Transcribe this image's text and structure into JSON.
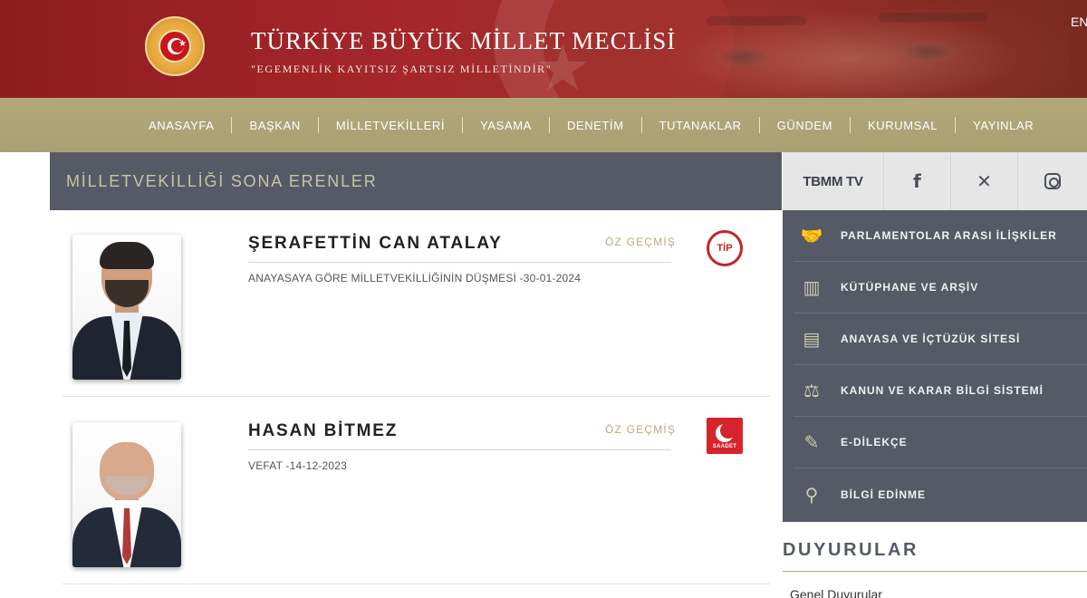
{
  "header": {
    "title": "TÜRKİYE BÜYÜK MİLLET MECLİSİ",
    "motto": "\"EGEMENLİK KAYITSIZ ŞARTSIZ MİLLETİNDİR\"",
    "lang": "EN",
    "logo_icon": "tbmm-emblem-icon"
  },
  "nav": {
    "items": [
      "ANASAYFA",
      "BAŞKAN",
      "MİLLETVEKİLLERİ",
      "YASAMA",
      "DENETİM",
      "TUTANAKLAR",
      "GÜNDEM",
      "KURUMSAL",
      "YAYINLAR"
    ]
  },
  "page": {
    "title": "MİLLETVEKİLLİĞİ SONA ERENLER"
  },
  "members": [
    {
      "name": "ŞERAFETTİN CAN ATALAY",
      "cv_label": "ÖZ GEÇMİŞ",
      "status": "ANAYASAYA GÖRE MİLLETVEKİLLİĞİNİN DÜŞMESİ -30-01-2024",
      "party_logo_text": "TİP",
      "party_color": "#c3262a"
    },
    {
      "name": "HASAN BİTMEZ",
      "cv_label": "ÖZ GEÇMİŞ",
      "status": "VEFAT -14-12-2023",
      "party_logo_text": "SAADET",
      "party_color": "#d7232c"
    }
  ],
  "sidebar": {
    "tv_label": "TBMM TV",
    "social_icons": [
      "facebook-icon",
      "x-icon",
      "instagram-icon"
    ],
    "links": [
      {
        "label": "PARLAMENTOLAR ARASI İLİŞKİLER",
        "icon": "handshake-icon"
      },
      {
        "label": "KÜTÜPHANE VE ARŞİV",
        "icon": "books-icon"
      },
      {
        "label": "ANAYASA VE İÇTÜZÜK SİTESİ",
        "icon": "browser-window-icon"
      },
      {
        "label": "KANUN VE KARAR BİLGİ SİSTEMİ",
        "icon": "scales-icon"
      },
      {
        "label": "E-DİLEKÇE",
        "icon": "quill-icon"
      },
      {
        "label": "BİLGİ EDİNME",
        "icon": "magnifier-icon"
      }
    ],
    "announcements_title": "DUYURULAR",
    "announcements_sub": "Genel Duyurular"
  },
  "colors": {
    "header_red": "#a4262a",
    "nav_khaki": "#aca276",
    "panel_slate": "#555a66",
    "accent_gold": "#b7ab7e"
  }
}
